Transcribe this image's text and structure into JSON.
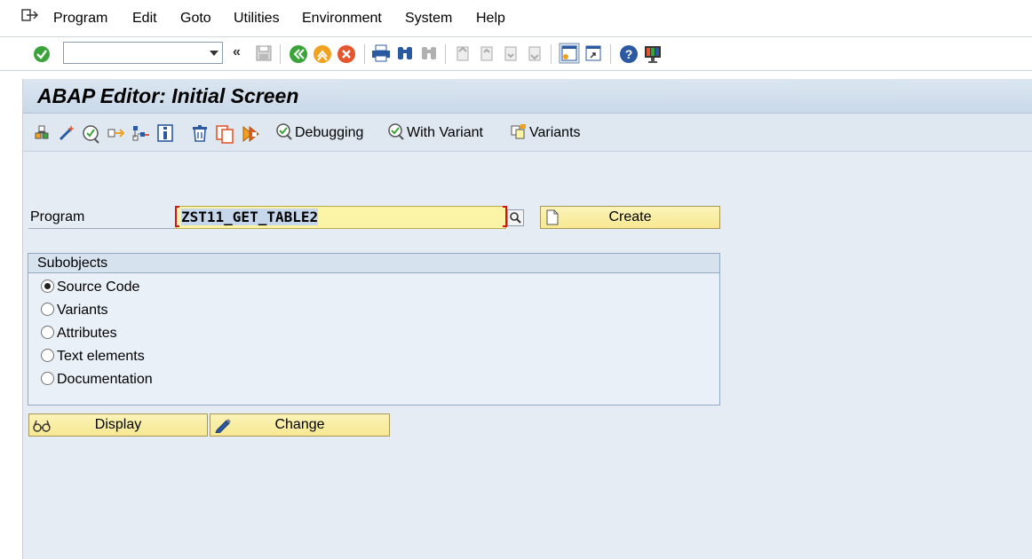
{
  "menu": {
    "items": [
      "Program",
      "Edit",
      "Goto",
      "Utilities",
      "Environment",
      "System",
      "Help"
    ],
    "icon": "menu-exit-icon"
  },
  "std_toolbar": {
    "command_value": "",
    "icons": [
      "enter-check-icon",
      "command-dropdown-icon",
      "collapse-chevrons-icon",
      "save-icon",
      "back-icon",
      "exit-icon",
      "cancel-icon",
      "print-icon",
      "find-icon",
      "find-next-icon",
      "first-page-icon",
      "previous-page-icon",
      "next-page-icon",
      "last-page-icon",
      "create-session-icon",
      "shortcut-icon",
      "help-icon",
      "customize-layout-icon"
    ]
  },
  "screen": {
    "title": "ABAP Editor: Initial Screen"
  },
  "app_toolbar": {
    "icons": [
      "object-list-icon",
      "magic-wand-icon",
      "check-icon",
      "activate-icon",
      "where-used-icon",
      "info-icon",
      "delete-icon",
      "copy-icon",
      "execute-icon"
    ],
    "buttons": [
      {
        "label": "Debugging",
        "icon": "debugging-icon"
      },
      {
        "label": "With Variant",
        "icon": "with-variant-icon"
      },
      {
        "label": "Variants",
        "icon": "variants-icon"
      }
    ]
  },
  "program_field": {
    "label": "Program",
    "value": "ZST11_GET_TABLE2"
  },
  "create_button": {
    "label": "Create"
  },
  "subobjects": {
    "title": "Subobjects",
    "options": [
      {
        "label": "Source Code",
        "selected": true
      },
      {
        "label": "Variants",
        "selected": false
      },
      {
        "label": "Attributes",
        "selected": false
      },
      {
        "label": "Text elements",
        "selected": false
      },
      {
        "label": "Documentation",
        "selected": false
      }
    ]
  },
  "actions": {
    "display_label": "Display",
    "change_label": "Change"
  },
  "colors": {
    "accent_green": "#3aa43a",
    "input_yellow": "#fbf3a5",
    "panel_blue": "#e5ecf4"
  }
}
